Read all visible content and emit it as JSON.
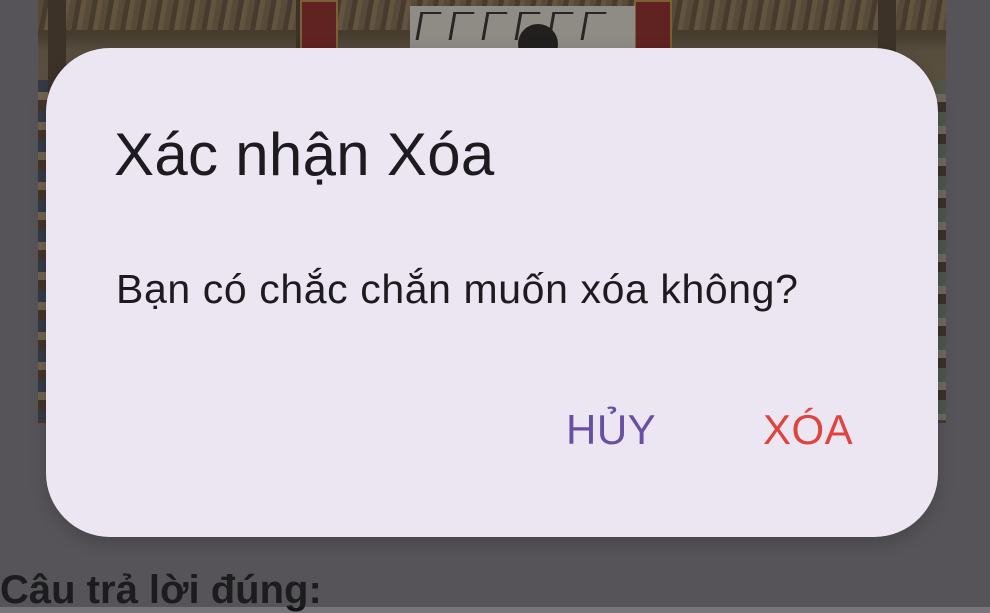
{
  "background": {
    "section_heading": "Câu trả lời đúng:"
  },
  "dialog": {
    "title": "Xác nhận Xóa",
    "message": "Bạn có chắc chắn muốn xóa không?",
    "cancel_label": "HỦY",
    "delete_label": "XÓA"
  },
  "colors": {
    "dialog_surface": "#ece6f2",
    "cancel_accent": "#6750a4",
    "delete_accent": "#e0443e",
    "scrim": "#77757a"
  }
}
